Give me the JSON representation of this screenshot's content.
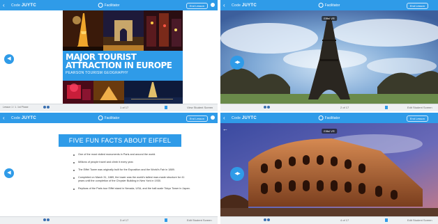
{
  "panels": [
    {
      "topbar": {
        "back": "‹",
        "code_prefix": "Code",
        "code": "JUYTC",
        "user": "Facilitator",
        "end": "End Lesson"
      },
      "slide": {
        "title": "MAJOR TOURIST ATTRACTION IN EUROPE",
        "subtitle": "PEARSON TOURISM GEOGRAPHY"
      },
      "bottom": {
        "note": "Lesson 1 / 1. 1st Phase",
        "page": "1 of 17",
        "link": "View Student Screen"
      }
    },
    {
      "topbar": {
        "back": "‹",
        "code_prefix": "Code",
        "code": "JUYTC",
        "user": "Facilitator",
        "end": "End Lesson"
      },
      "caption": "Eiffel VR",
      "bottom": {
        "page": "2 of 17",
        "link": "Edit Student Screen"
      }
    },
    {
      "topbar": {
        "back": "‹",
        "code_prefix": "Code",
        "code": "JUYTC",
        "user": "Facilitator",
        "end": "End Lesson"
      },
      "slide": {
        "heading": "FIVE FUN FACTS ABOUT EIFFEL TOWER",
        "facts": [
          "One of the most visited monuments in Paris and around the world.",
          "Millions of people travel and climb it every year.",
          "The Eiffel Tower was originally built for the Exposition and the World's Fair in 1889.",
          "Completed on March 31, 1889, the tower was the world's tallest man-made structure for 41 years until the completion of the Chrysler Building in New York in 1930.",
          "Replicas of the Paris tour Eiffel stand in Nevada, USA, and the half-scale Tokyo Tower in Japan."
        ]
      },
      "bottom": {
        "page": "3 of 17",
        "link": "Edit Student Screen"
      }
    },
    {
      "topbar": {
        "back": "‹",
        "code_prefix": "Code",
        "code": "JUYTC",
        "user": "Facilitator",
        "end": "End Lesson"
      },
      "caption": "Eiffel VR",
      "bottom": {
        "page": "4 of 17",
        "link": "Edit Student Screen"
      }
    }
  ],
  "colors": {
    "accent": "#2f9be8",
    "bar": "#eef0f2"
  }
}
